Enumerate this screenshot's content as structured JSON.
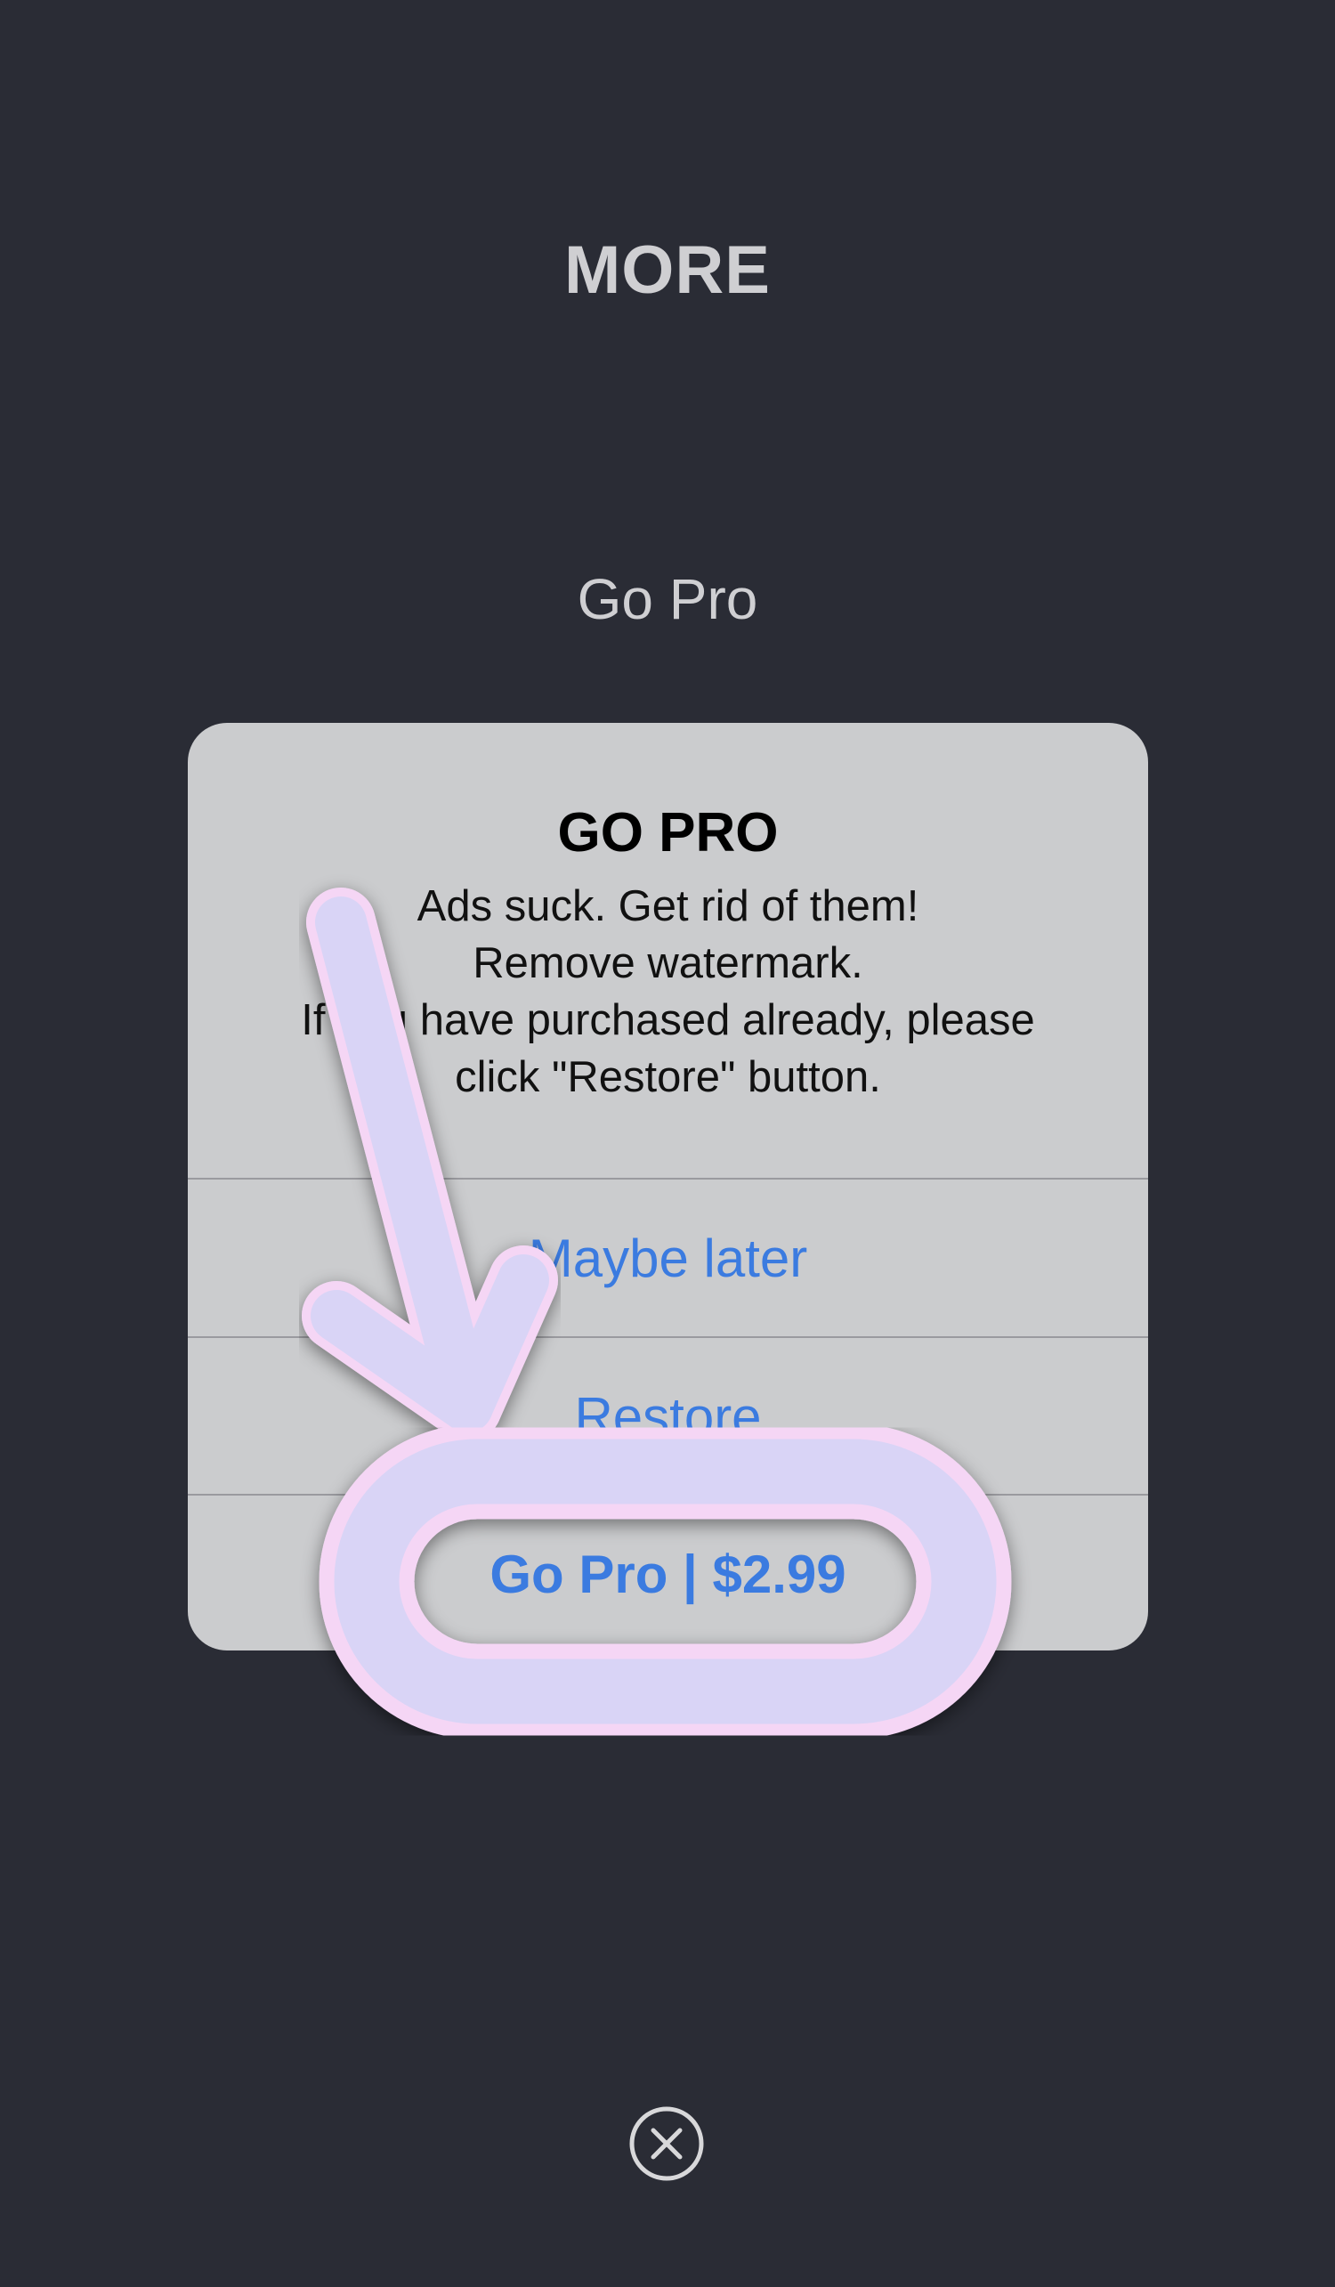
{
  "header": {
    "title": "MORE"
  },
  "menu": {
    "items": [
      {
        "label": "Go Pro"
      }
    ]
  },
  "dialog": {
    "title": "GO PRO",
    "message_lines": [
      "Ads suck. Get rid of them!",
      "Remove watermark.",
      "If you have purchased already, please",
      "click \"Restore\" button."
    ],
    "buttons": {
      "later": "Maybe later",
      "restore": "Restore",
      "gopro": "Go Pro | $2.99"
    }
  },
  "annotation": {
    "icon": "arrow-pointer-icon",
    "highlight": "rounded-outline"
  },
  "icons": {
    "close": "close-circle-icon"
  },
  "colors": {
    "background": "#2a2c35",
    "dialog": "#cbccce",
    "link": "#3b7be0",
    "annotation_fill": "#d9d4f6",
    "annotation_outline": "#f5d6f5"
  }
}
